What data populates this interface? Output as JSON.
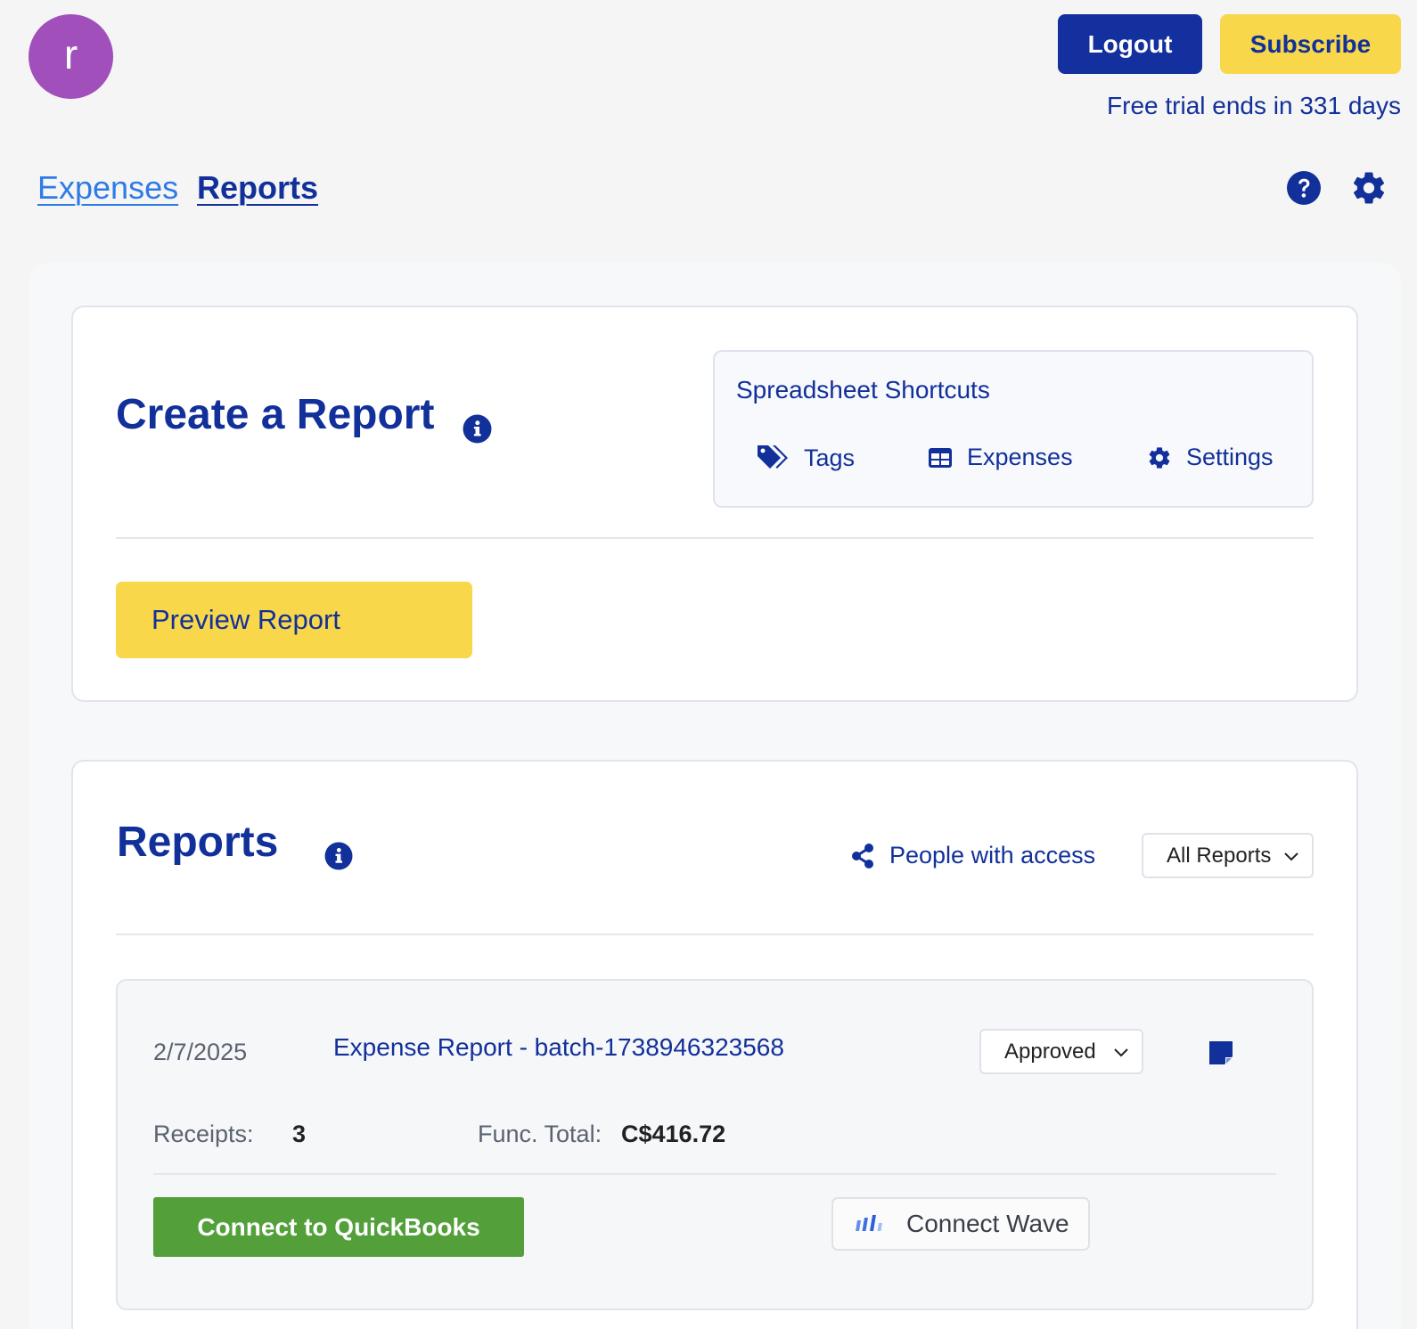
{
  "header": {
    "avatar_letter": "r",
    "logout_label": "Logout",
    "subscribe_label": "Subscribe",
    "trial_text": "Free trial ends in 331 days"
  },
  "nav": {
    "expenses_label": "Expenses",
    "reports_label": "Reports"
  },
  "create_report": {
    "title": "Create a Report",
    "shortcuts_title": "Spreadsheet Shortcuts",
    "shortcuts": [
      {
        "label": "Tags",
        "icon": "tags-icon"
      },
      {
        "label": "Expenses",
        "icon": "table-icon"
      },
      {
        "label": "Settings",
        "icon": "gear-icon"
      }
    ],
    "preview_label": "Preview Report"
  },
  "reports": {
    "title": "Reports",
    "people_access_label": "People with access",
    "filter_selected": "All Reports",
    "items": [
      {
        "date": "2/7/2025",
        "title": "Expense Report - batch-1738946323568",
        "status": "Approved",
        "receipts_label": "Receipts:",
        "receipts_count": "3",
        "total_label": "Func. Total:",
        "total_value": "C$416.72",
        "quickbooks_label": "Connect to QuickBooks",
        "wave_label": "Connect Wave"
      }
    ]
  },
  "colors": {
    "brand_blue": "#12309a",
    "logout_bg": "#14309e",
    "accent_yellow": "#f8d84a",
    "avatar_purple": "#a04fbb",
    "link_blue": "#2f7be6",
    "quickbooks_green": "#53a03a"
  }
}
